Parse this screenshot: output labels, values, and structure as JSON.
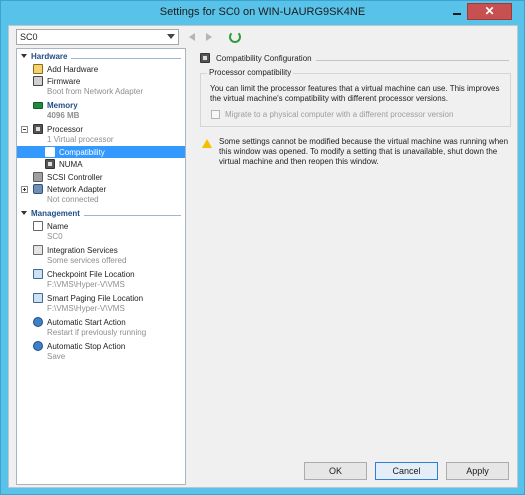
{
  "window": {
    "title": "Settings for SC0 on WIN-UAURG9SK4NE",
    "minimize": "",
    "close": "✕"
  },
  "vm_selector": {
    "value": "SC0"
  },
  "tree": {
    "hardware_header": "Hardware",
    "add_hardware": "Add Hardware",
    "firmware": "Firmware",
    "firmware_sub": "Boot from Network Adapter",
    "memory": "Memory",
    "memory_sub": "4096 MB",
    "processor": "Processor",
    "processor_sub": "1 Virtual processor",
    "compatibility": "Compatibility",
    "numa": "NUMA",
    "scsi": "SCSI Controller",
    "network": "Network Adapter",
    "network_sub": "Not connected",
    "management_header": "Management",
    "name": "Name",
    "name_sub": "SC0",
    "integration": "Integration Services",
    "integration_sub": "Some services offered",
    "checkpoint": "Checkpoint File Location",
    "checkpoint_sub": "F:\\VMS\\Hyper-V\\VMS",
    "paging": "Smart Paging File Location",
    "paging_sub": "F:\\VMS\\Hyper-V\\VMS",
    "autostart": "Automatic Start Action",
    "autostart_sub": "Restart if previously running",
    "autostop": "Automatic Stop Action",
    "autostop_sub": "Save"
  },
  "panel": {
    "heading": "Compatibility Configuration",
    "group_label": "Processor compatibility",
    "description": "You can limit the processor features that a virtual machine can use. This improves the virtual machine's compatibility with different processor versions.",
    "checkbox_label": "Migrate to a physical computer with a different processor version",
    "checkbox_checked": false,
    "warning": "Some settings cannot be modified because the virtual machine was running when this window was opened. To modify a setting that is unavailable, shut down the virtual machine and then reopen this window."
  },
  "buttons": {
    "ok": "OK",
    "cancel": "Cancel",
    "apply": "Apply"
  },
  "colors": {
    "frame": "#59c2e8",
    "selection": "#3399ff",
    "section_header": "#1f4d86"
  }
}
